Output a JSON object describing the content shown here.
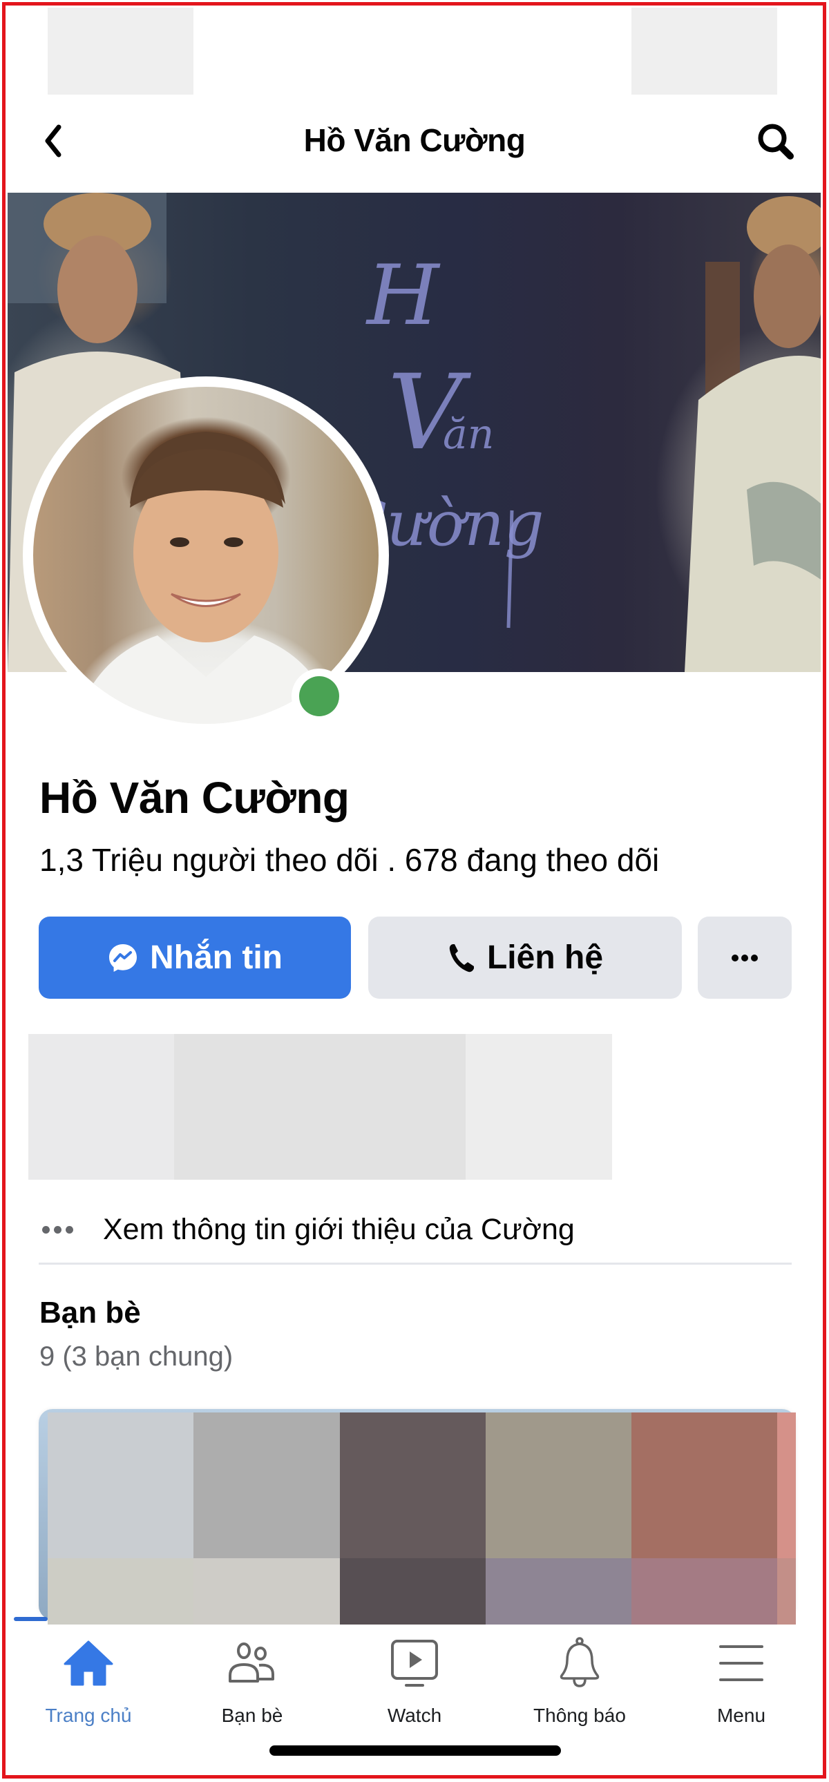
{
  "header": {
    "title": "Hồ Văn Cường",
    "back_icon": "chevron-left-icon",
    "search_icon": "search-icon"
  },
  "cover": {
    "calligraphy_text": "Hồ Văn Cường"
  },
  "profile": {
    "name": "Hồ Văn Cường",
    "stats": "1,3 Triệu người theo dõi . 678 đang theo dõi",
    "online": true,
    "online_color": "#4aa354"
  },
  "actions": {
    "message": {
      "label": "Nhắn tin",
      "icon": "messenger-icon",
      "color": "#3578e5"
    },
    "contact": {
      "label": "Liên hệ",
      "icon": "phone-icon"
    },
    "more": {
      "label": "•••",
      "icon": "more-icon"
    }
  },
  "about": {
    "label": "Xem thông tin giới thiệu của Cường",
    "icon": "more-dots-icon"
  },
  "friends": {
    "title": "Bạn bè",
    "count": "9 (3 bạn chung)",
    "mosaic_colors": [
      [
        "#c9cdd1",
        "#adadad",
        "#655a5c",
        "#a0998b",
        "#a46f63",
        "#d59189"
      ],
      [
        "#cdcdc5",
        "#ceccc7",
        "#574f53",
        "#8e8594",
        "#a47b84",
        "#c38f88"
      ]
    ]
  },
  "bottom_nav": {
    "items": [
      {
        "label": "Trang chủ",
        "icon": "home-icon",
        "active": true
      },
      {
        "label": "Bạn bè",
        "icon": "friends-icon",
        "active": false
      },
      {
        "label": "Watch",
        "icon": "watch-icon",
        "active": false
      },
      {
        "label": "Thông báo",
        "icon": "bell-icon",
        "active": false
      },
      {
        "label": "Menu",
        "icon": "menu-icon",
        "active": false
      }
    ],
    "active_color": "#3578e5"
  }
}
